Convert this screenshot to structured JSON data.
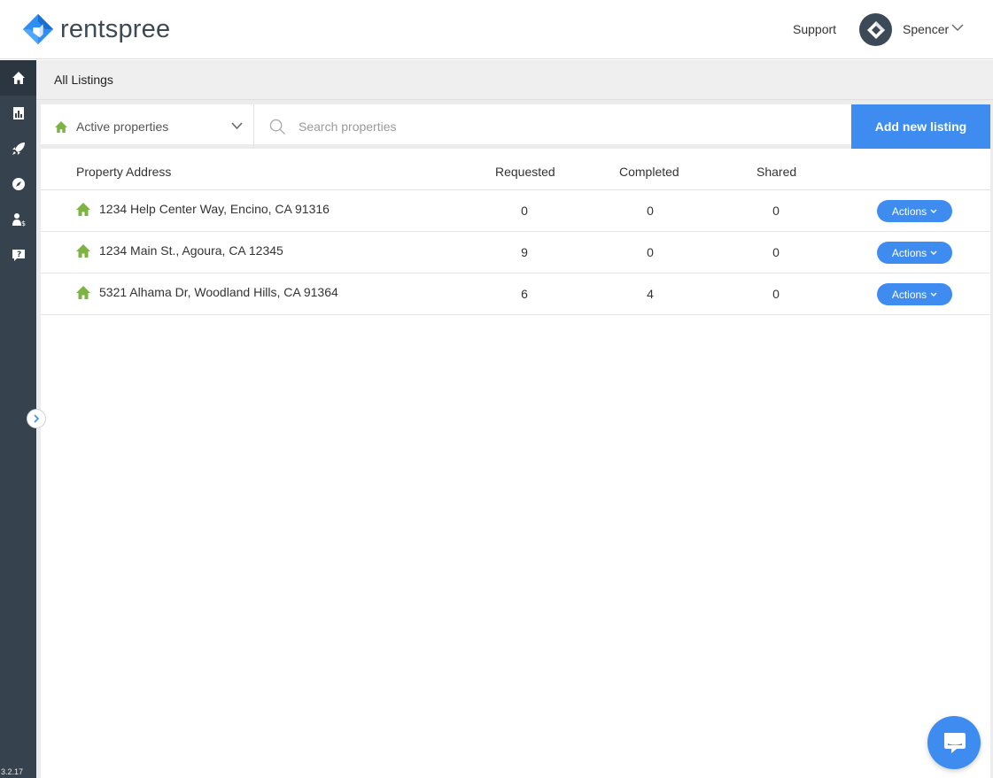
{
  "app": {
    "logo_text_a": "rent",
    "logo_text_b": "spree",
    "version": "3.2.17"
  },
  "header": {
    "support_label": "Support",
    "user_name": "Spencer"
  },
  "sidebar": {
    "items": [
      {
        "name": "home-icon",
        "active": true
      },
      {
        "name": "report-icon",
        "active": false
      },
      {
        "name": "rocket-icon",
        "active": false
      },
      {
        "name": "compass-icon",
        "active": false
      },
      {
        "name": "agent-money-icon",
        "active": false
      },
      {
        "name": "help-chat-icon",
        "active": false
      }
    ]
  },
  "breadcrumb": {
    "label": "All Listings"
  },
  "filter": {
    "selected": "Active properties"
  },
  "search": {
    "placeholder": "Search properties"
  },
  "add_listing": {
    "label": "Add new listing"
  },
  "table": {
    "headers": {
      "address": "Property Address",
      "requested": "Requested",
      "completed": "Completed",
      "shared": "Shared"
    },
    "rows": [
      {
        "address": "1234 Help Center Way, Encino, CA 91316",
        "requested": "0",
        "completed": "0",
        "shared": "0",
        "action": "Actions"
      },
      {
        "address": "1234 Main St., Agoura, CA 12345",
        "requested": "9",
        "completed": "0",
        "shared": "0",
        "action": "Actions"
      },
      {
        "address": "5321 Alhama Dr, Woodland Hills, CA 91364",
        "requested": "6",
        "completed": "4",
        "shared": "0",
        "action": "Actions"
      }
    ]
  },
  "colors": {
    "accent": "#3e8cf0",
    "sidebar": "#36434f",
    "home_green": "#7cb342"
  }
}
